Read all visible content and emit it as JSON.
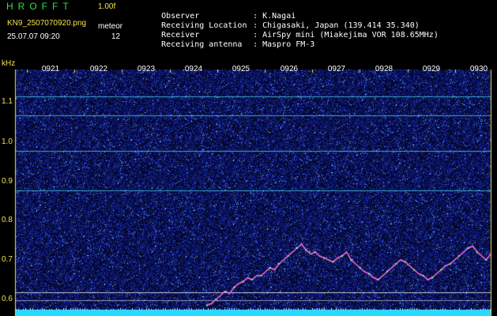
{
  "header": {
    "app_name": "HROFFT",
    "version": "1.00f",
    "filename": "KN9_2507070920.png",
    "timestamp": "25.07.07 09:20",
    "meteor_label": "meteor",
    "meteor_count": "12"
  },
  "info": [
    {
      "key": "Observer",
      "sep": ":",
      "value": "K.Nagai"
    },
    {
      "key": "Receiving Location",
      "sep": ":",
      "value": "Chigasaki, Japan (139.414 35.340)"
    },
    {
      "key": "Receiver",
      "sep": ":",
      "value": "AirSpy mini (Miakejima VOR 108.65MHz)"
    },
    {
      "key": "Receiving antenna",
      "sep": ":",
      "value": "Maspro FM-3"
    }
  ],
  "axes": {
    "y_unit": "kHz",
    "y_labels": [
      "1.1",
      "1.0",
      "0.9",
      "0.8",
      "0.7",
      "0.6"
    ],
    "y_values": [
      1.1,
      1.0,
      0.9,
      0.8,
      0.7,
      0.6
    ],
    "x_labels": [
      "0921",
      "0922",
      "0923",
      "0924",
      "0925",
      "0926",
      "0927",
      "0928",
      "0929",
      "0930"
    ]
  },
  "colors": {
    "background": "#000000",
    "noise_blue": "#2a3fd0",
    "line_cyan": "#4fe6ff",
    "trace_pink": "#ff6fd8",
    "trace_green": "#7dff7a",
    "label_yellow": "#f4e24c",
    "title_green": "#2ee04a",
    "bottom_band": "#27d8ff"
  },
  "horizontal_lines_khz": [
    1.115,
    1.066,
    0.977,
    0.877,
    0.618
  ],
  "trace_khz": [
    [
      0.585,
      0.59
    ],
    [
      0.6,
      0.61
    ],
    [
      0.62,
      0.615
    ],
    [
      0.63,
      0.64
    ],
    [
      0.645,
      0.655
    ],
    [
      0.65,
      0.66
    ],
    [
      0.66,
      0.67
    ],
    [
      0.68,
      0.675
    ],
    [
      0.69,
      0.7
    ],
    [
      0.71,
      0.72
    ],
    [
      0.73,
      0.74
    ],
    [
      0.725,
      0.715
    ],
    [
      0.72,
      0.71
    ],
    [
      0.705,
      0.7
    ],
    [
      0.695,
      0.705
    ],
    [
      0.71,
      0.72
    ],
    [
      0.7,
      0.69
    ],
    [
      0.68,
      0.67
    ],
    [
      0.665,
      0.655
    ],
    [
      0.65,
      0.66
    ],
    [
      0.67,
      0.68
    ],
    [
      0.69,
      0.7
    ],
    [
      0.695,
      0.685
    ],
    [
      0.675,
      0.665
    ],
    [
      0.66,
      0.65
    ],
    [
      0.655,
      0.665
    ],
    [
      0.675,
      0.685
    ],
    [
      0.69,
      0.7
    ],
    [
      0.71,
      0.72
    ],
    [
      0.73,
      0.735
    ],
    [
      0.72,
      0.71
    ],
    [
      0.7,
      0.715
    ]
  ]
}
